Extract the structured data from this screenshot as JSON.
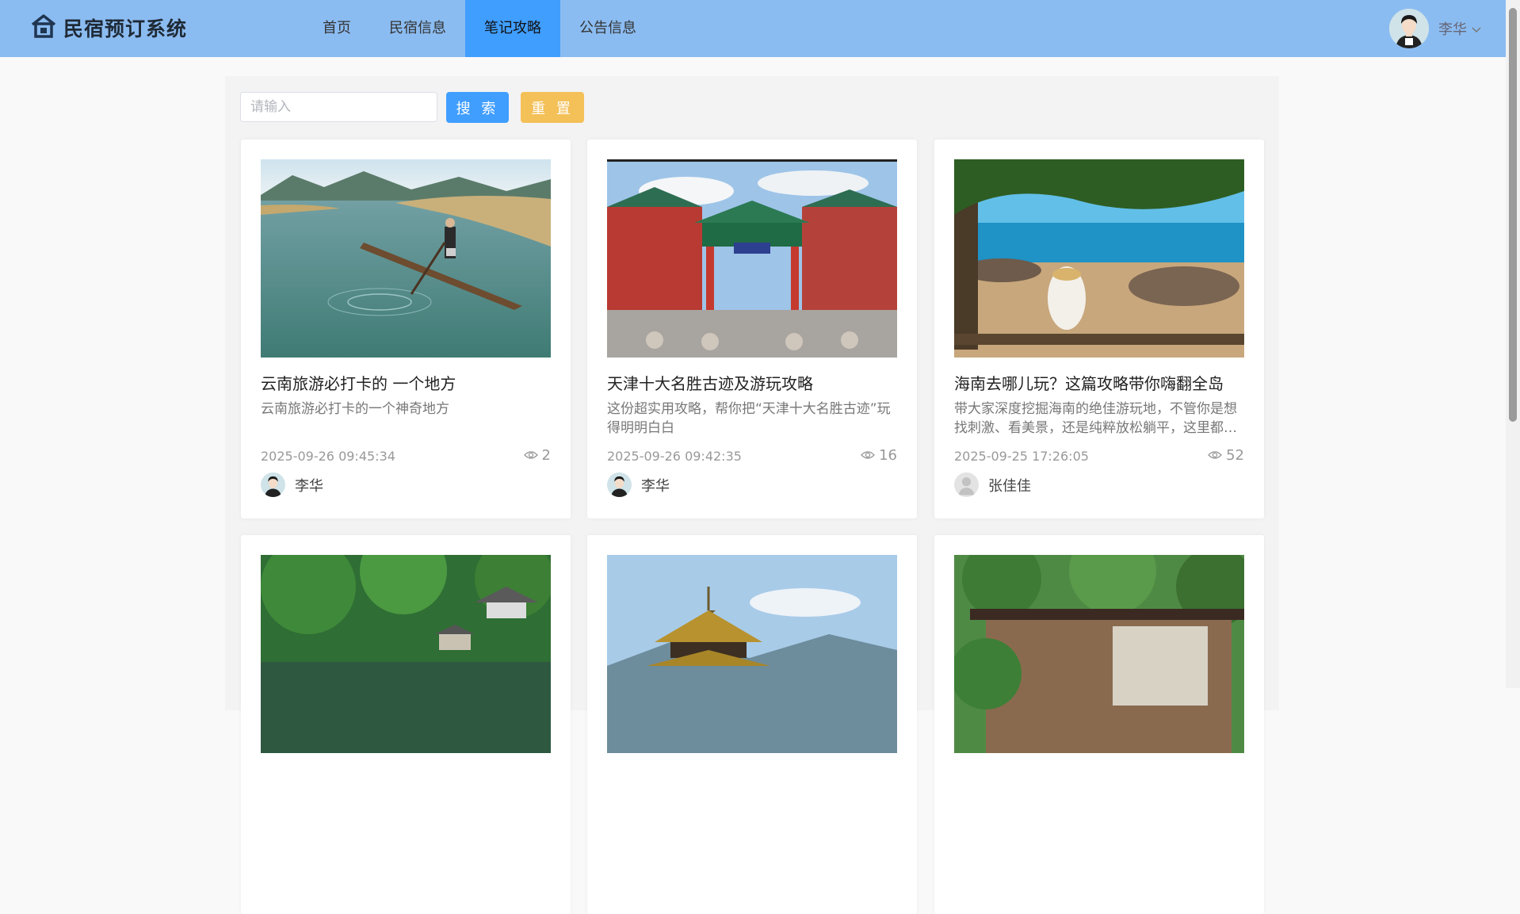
{
  "header": {
    "app_title": "民宿预订系统",
    "nav": [
      {
        "label": "首页",
        "active": false
      },
      {
        "label": "民宿信息",
        "active": false
      },
      {
        "label": "笔记攻略",
        "active": true
      },
      {
        "label": "公告信息",
        "active": false
      }
    ],
    "user_name": "李华",
    "background_color": "#8bbcf1",
    "active_color": "#409eff"
  },
  "search": {
    "placeholder": "请输入",
    "value": "",
    "search_label": "搜 索",
    "reset_label": "重 置"
  },
  "cards": [
    {
      "title": "云南旅游必打卡的 一个地方",
      "desc": "云南旅游必打卡的一个神奇地方",
      "date": "2025-09-26 09:45:34",
      "views": "2",
      "author": "李华",
      "image": "lake-boat"
    },
    {
      "title": "天津十大名胜古迹及游玩攻略",
      "desc": "这份超实用攻略，帮你把“天津十大名胜古迹”玩得明明白白",
      "date": "2025-09-26 09:42:35",
      "views": "16",
      "author": "李华",
      "image": "chinese-gate"
    },
    {
      "title": "海南去哪儿玩？这篇攻略带你嗨翻全岛",
      "desc": "带大家深度挖掘海南的绝佳游玩地，不管你是想找刺激、看美景，还是纯粹放松躺平，这里都能满足你",
      "date": "2025-09-25 17:26:05",
      "views": "52",
      "author": "张佳佳",
      "image": "beach"
    },
    {
      "title": "",
      "desc": "",
      "date": "",
      "views": "",
      "author": "",
      "image": "forest-pavilion"
    },
    {
      "title": "",
      "desc": "",
      "date": "",
      "views": "",
      "author": "",
      "image": "pagoda"
    },
    {
      "title": "",
      "desc": "",
      "date": "",
      "views": "",
      "author": "",
      "image": "garden-house"
    }
  ]
}
